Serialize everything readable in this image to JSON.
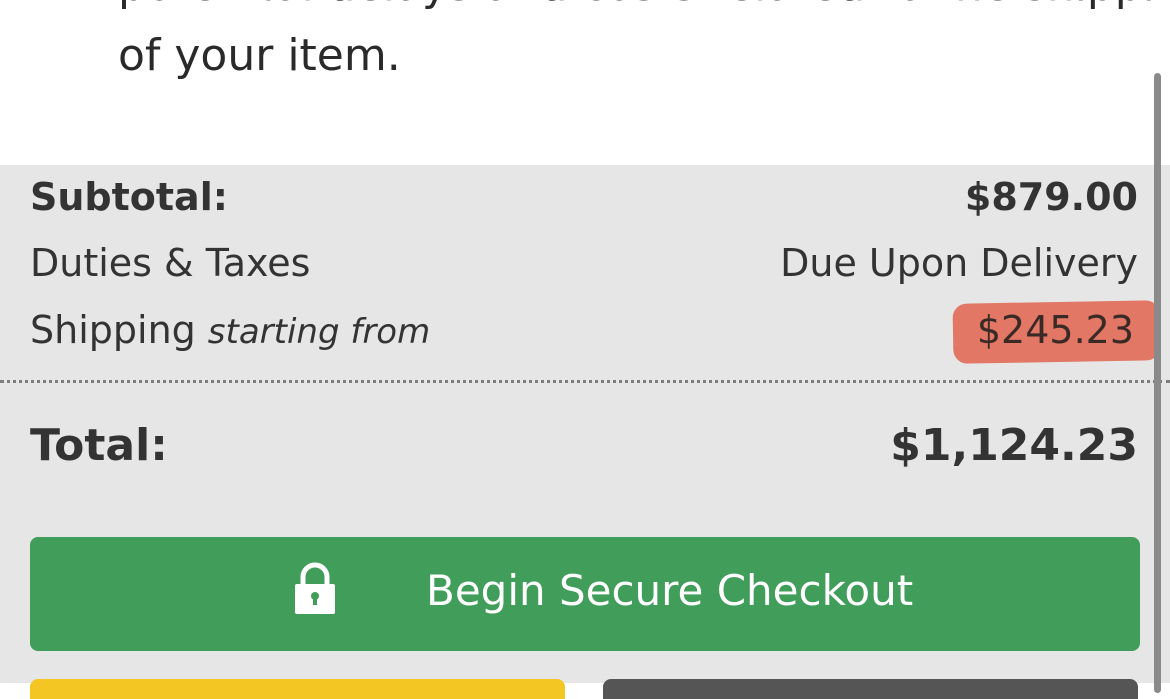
{
  "note": {
    "cut_line": "potential delays and costs related to the shipping",
    "last_line": "of your item."
  },
  "summary": {
    "subtotal_label": "Subtotal:",
    "subtotal_value": "$879.00",
    "duties_label": "Duties & Taxes",
    "duties_value": "Due Upon Delivery",
    "shipping_label": "Shipping",
    "shipping_note": "starting from",
    "shipping_value": "$245.23",
    "total_label": "Total:",
    "total_value": "$1,124.23"
  },
  "checkout": {
    "label": "Begin Secure Checkout"
  },
  "colors": {
    "checkout_green": "#419d5a",
    "highlight_red": "#e06a55",
    "summary_bg": "#e6e6e6"
  }
}
